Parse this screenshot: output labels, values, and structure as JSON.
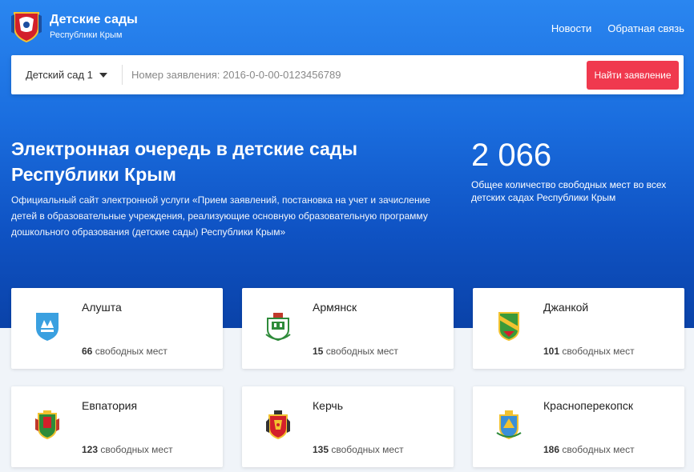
{
  "header": {
    "title": "Детские сады",
    "subtitle": "Республики Крым",
    "nav": [
      {
        "label": "Новости"
      },
      {
        "label": "Обратная связь"
      }
    ]
  },
  "search": {
    "select_value": "Детский сад 1",
    "placeholder": "Номер заявления: 2016-0-0-00-0123456789",
    "button_label": "Найти заявление"
  },
  "hero": {
    "title": "Электронная очередь в детские сады Республики Крым",
    "description": "Официальный сайт электронной услуги «Прием заявлений, постановка на учет и зачисление детей в образовательные учреждения, реализующие основную образовательную программу дошкольного образования (детские сады) Республики Крым»",
    "stat_number": "2 066",
    "stat_label": "Общее количество свободных мест во всех детских садах Республики Крым"
  },
  "cards_suffix": "свободных мест",
  "cards": [
    {
      "name": "Алушта",
      "count": "66"
    },
    {
      "name": "Армянск",
      "count": "15"
    },
    {
      "name": "Джанкой",
      "count": "101"
    },
    {
      "name": "Евпатория",
      "count": "123"
    },
    {
      "name": "Керчь",
      "count": "135"
    },
    {
      "name": "Красноперекопск",
      "count": "186"
    }
  ],
  "colors": {
    "accent_button": "#f0394e",
    "hero_blue": "#1b6fe0"
  }
}
